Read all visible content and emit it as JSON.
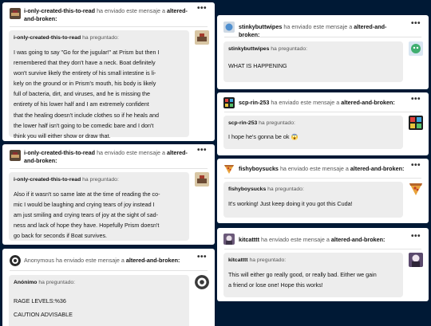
{
  "common": {
    "sent_text": "ha enviado este mensaje a",
    "recipient": "altered-and-broken:",
    "asked_text": "ha preguntado:",
    "more_icon": "•••"
  },
  "posts": [
    {
      "sender": "i-only-created-this-to-read",
      "asker": "i-only-created-this-to-read",
      "lines": [
        "I was going to say \"Go for the jugular!\" at Prism but then I",
        "remembered that they don't have a neck. Boat definitely",
        "won't survive likely the entirety of his small intestine is li-",
        "kely on the ground or in Prism's mouth, his body is likely",
        "full of bacteria, dirt,  and viruses, and he is missing the",
        "entirety of his lower half and I am extremely confident",
        "that the healing doesn't include clothes so if he heals and",
        "the lower half isn't going to be comedic bare and I don't",
        "think you will either show or draw that."
      ]
    },
    {
      "sender": "i-only-created-this-to-read",
      "asker": "i-only-created-this-to-read",
      "lines": [
        "Also if it wasn't so same late at the time of reading the co-",
        "mic I would be laughing and crying tears of joy instead I",
        "am just smiling and crying tears of joy at the sight of sad-",
        "ness and lack of hope they have. Hopefully Prism doesn't",
        "go back for seconds if Boat survives."
      ]
    },
    {
      "sender": "Anonymous",
      "asker": "Anónimo",
      "lines": [
        "RAGE LEVELS:%36",
        "CAUTION ADVISABLE"
      ]
    },
    {
      "sender": "stinkybuttwipes",
      "asker": "stinkybuttwipes",
      "lines": [
        "WHAT IS HAPPENING"
      ]
    },
    {
      "sender": "scp-rin-253",
      "asker": "scp-rin-253",
      "lines": [
        "I hope he's gonna be ok 😱"
      ]
    },
    {
      "sender": "fishyboysucks",
      "asker": "fishyboysucks",
      "lines": [
        "It's working! Just keep doing it you got this Cuda!"
      ]
    },
    {
      "sender": "kitcatttt",
      "asker": "kitcatttt",
      "lines": [
        "This will either go really good, or really bad. Either we gain",
        "a friend or lose one! Hope this works!"
      ]
    }
  ]
}
